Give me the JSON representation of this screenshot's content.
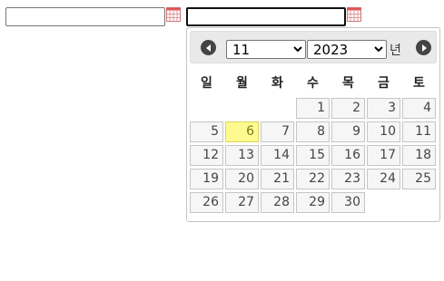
{
  "inputs": [
    {
      "value": "",
      "calendar_icon": "calendar-icon"
    },
    {
      "value": "",
      "calendar_icon": "calendar-icon"
    }
  ],
  "datepicker": {
    "prev_icon": "circle-triangle-left-icon",
    "next_icon": "circle-triangle-right-icon",
    "month_selected": "11",
    "year_selected": "2023",
    "year_suffix": "년",
    "weekdays": [
      "일",
      "월",
      "화",
      "수",
      "목",
      "금",
      "토"
    ],
    "leading_blank_days": 3,
    "days": [
      "1",
      "2",
      "3",
      "4",
      "5",
      "6",
      "7",
      "8",
      "9",
      "10",
      "11",
      "12",
      "13",
      "14",
      "15",
      "16",
      "17",
      "18",
      "19",
      "20",
      "21",
      "22",
      "23",
      "24",
      "25",
      "26",
      "27",
      "28",
      "29",
      "30"
    ],
    "highlighted_day": "6"
  },
  "colors": {
    "highlight_bg": "#fffa90",
    "day_bg": "#f6f6f6",
    "header_bg": "#e9e9e9"
  }
}
